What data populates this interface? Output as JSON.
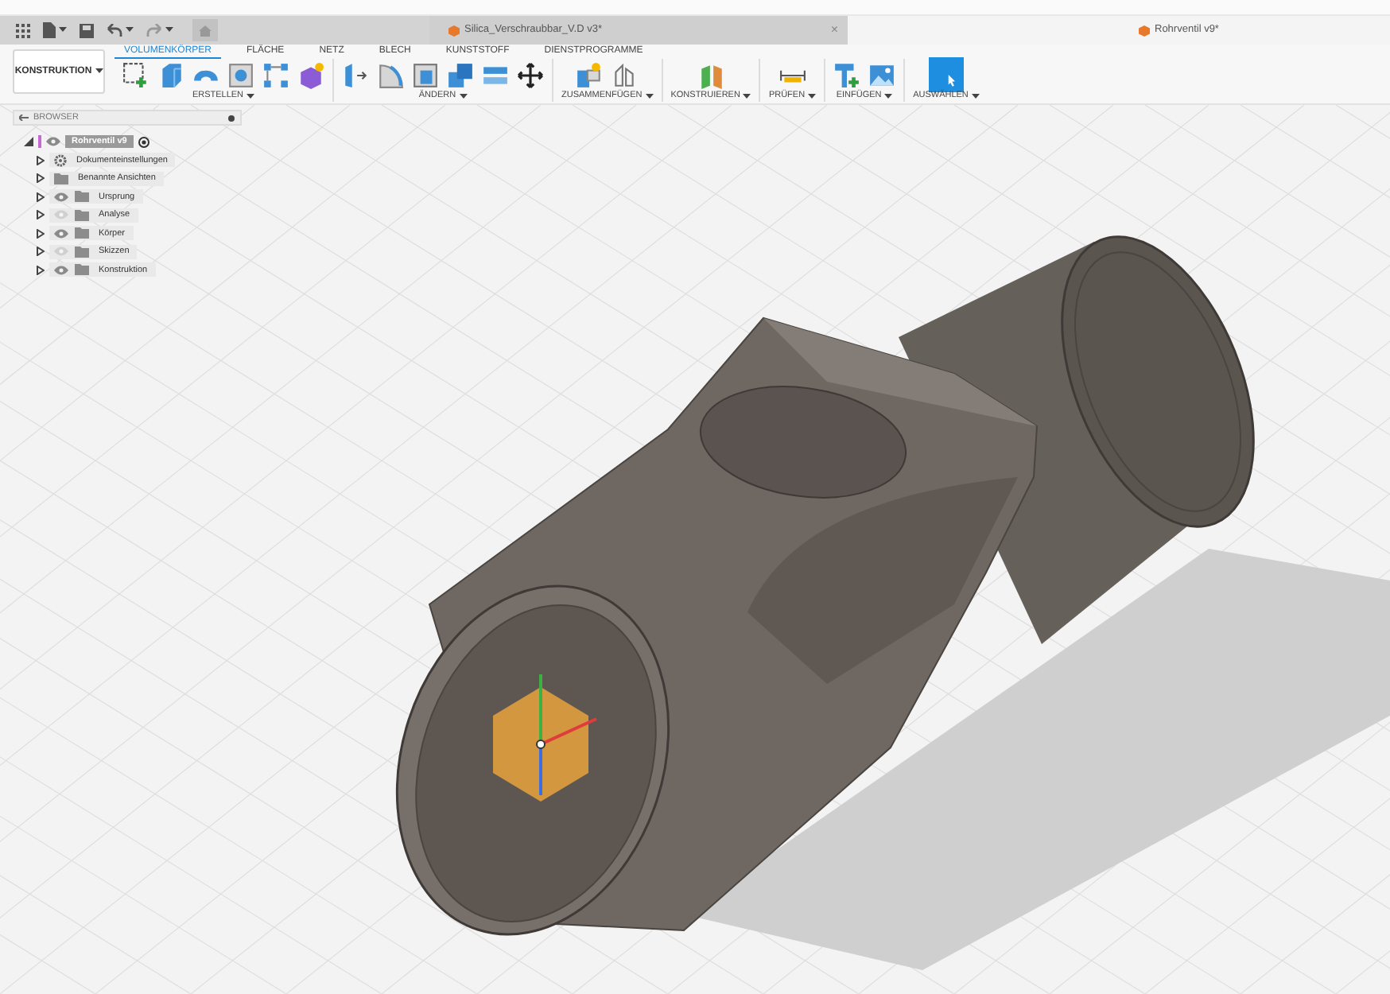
{
  "document_tabs": [
    {
      "title": "Silica_Verschraubbar_V.D v3*",
      "selected": false,
      "close": "×"
    },
    {
      "title": "Rohrventil v9*",
      "selected": true
    }
  ],
  "ribbon": {
    "workspace": "KONSTRUKTION",
    "tabs": [
      {
        "label": "VOLUMENKÖRPER",
        "selected": true
      },
      {
        "label": "FLÄCHE",
        "selected": false
      },
      {
        "label": "NETZ",
        "selected": false
      },
      {
        "label": "BLECH",
        "selected": false
      },
      {
        "label": "KUNSTSTOFF",
        "selected": false
      },
      {
        "label": "DIENSTPROGRAMME",
        "selected": false
      }
    ],
    "groups": [
      {
        "label": "ERSTELLEN"
      },
      {
        "label": "ÄNDERN"
      },
      {
        "label": "ZUSAMMENFÜGEN"
      },
      {
        "label": "KONSTRUIEREN"
      },
      {
        "label": "PRÜFEN"
      },
      {
        "label": "EINFÜGEN"
      },
      {
        "label": "AUSWÄHLEN"
      }
    ]
  },
  "browser": {
    "title": "BROWSER",
    "root": {
      "label": "Rohrventil v9",
      "children": [
        {
          "label": "Dokumenteinstellungen",
          "kind": "settings"
        },
        {
          "label": "Benannte Ansichten",
          "kind": "views"
        },
        {
          "label": "Ursprung",
          "kind": "folder",
          "visible": true
        },
        {
          "label": "Analyse",
          "kind": "folder",
          "visible": false
        },
        {
          "label": "Körper",
          "kind": "folder",
          "visible": true
        },
        {
          "label": "Skizzen",
          "kind": "folder",
          "visible": false
        },
        {
          "label": "Konstruktion",
          "kind": "folder",
          "visible": true
        }
      ]
    }
  }
}
